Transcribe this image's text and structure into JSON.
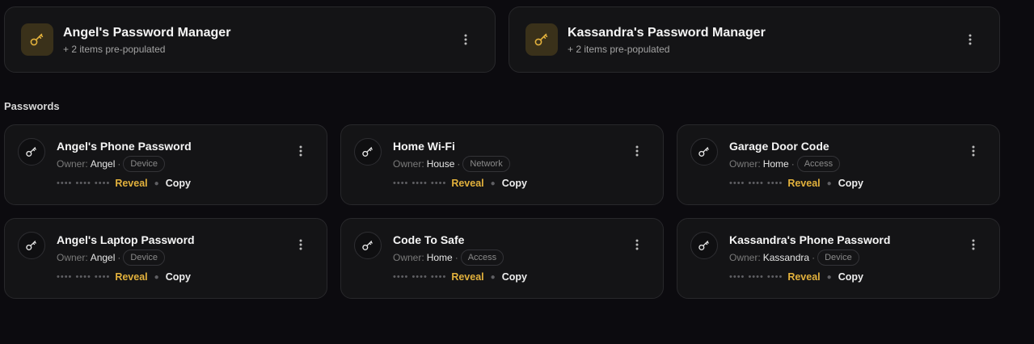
{
  "managers": [
    {
      "title": "Angel's Password Manager",
      "subtitle": "+ 2 items pre-populated",
      "icon": "key-icon"
    },
    {
      "title": "Kassandra's Password Manager",
      "subtitle": "+ 2 items pre-populated",
      "icon": "key-icon"
    }
  ],
  "section": {
    "title": "Passwords"
  },
  "passwords": [
    {
      "name": "Angel's Phone Password",
      "owner_label": "Owner:",
      "owner": "Angel",
      "tag": "Device",
      "masked": "•••• •••• ••••",
      "reveal": "Reveal",
      "copy": "Copy"
    },
    {
      "name": "Home Wi-Fi",
      "owner_label": "Owner:",
      "owner": "House",
      "tag": "Network",
      "masked": "•••• •••• ••••",
      "reveal": "Reveal",
      "copy": "Copy"
    },
    {
      "name": "Garage Door Code",
      "owner_label": "Owner:",
      "owner": "Home",
      "tag": "Access",
      "masked": "•••• •••• ••••",
      "reveal": "Reveal",
      "copy": "Copy"
    },
    {
      "name": "Angel's Laptop Password",
      "owner_label": "Owner:",
      "owner": "Angel",
      "tag": "Device",
      "masked": "•••• •••• ••••",
      "reveal": "Reveal",
      "copy": "Copy"
    },
    {
      "name": "Code To Safe",
      "owner_label": "Owner:",
      "owner": "Home",
      "tag": "Access",
      "masked": "•••• •••• ••••",
      "reveal": "Reveal",
      "copy": "Copy"
    },
    {
      "name": "Kassandra's Phone Password",
      "owner_label": "Owner:",
      "owner": "Kassandra",
      "tag": "Device",
      "masked": "•••• •••• ••••",
      "reveal": "Reveal",
      "copy": "Copy"
    }
  ],
  "colors": {
    "accent": "#e2b13c",
    "background": "#0c0b0f",
    "card": "#141416"
  }
}
